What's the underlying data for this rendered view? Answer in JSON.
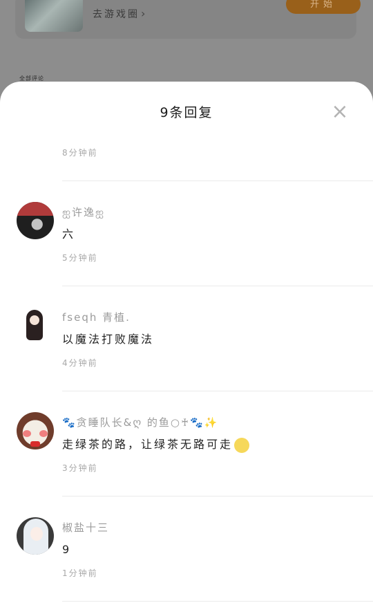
{
  "background": {
    "game_title": "",
    "game_subtitle": "去游戏圈",
    "start_button": "开始",
    "section_label": "全部评论"
  },
  "sheet": {
    "title": "9条回复",
    "close_icon": "×"
  },
  "comments": [
    {
      "author": "",
      "text": "",
      "time": "8分钟前"
    },
    {
      "author": "ஐ许逸ஐ",
      "text": "六",
      "time": "5分钟前"
    },
    {
      "author": "fseqh 青植.",
      "text": "以魔法打败魔法",
      "time": "4分钟前"
    },
    {
      "author": "🐾贪睡队长&ღ 的鱼○♰🐾✨",
      "text": "走绿茶的路，让绿茶无路可走",
      "time": "3分钟前"
    },
    {
      "author": "椒盐十三",
      "text": "9",
      "time": "1分钟前"
    }
  ],
  "colors": {
    "accent_button": "#99601a",
    "sheet_background": "#ffffff",
    "overlay": "#8c8c8c"
  }
}
